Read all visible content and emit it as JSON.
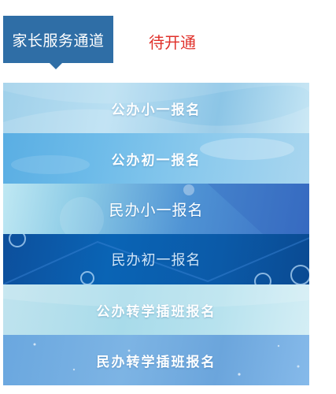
{
  "header": {
    "tab_label": "家长服务通道",
    "status": "待开通"
  },
  "banners": [
    {
      "label": "公办小一报名"
    },
    {
      "label": "公办初一报名"
    },
    {
      "label": "民办小一报名"
    },
    {
      "label": "民办初一报名"
    },
    {
      "label": "公办转学插班报名"
    },
    {
      "label": "民办转学插班报名"
    }
  ],
  "colors": {
    "tab_background": "#2f6ea6",
    "status_text": "#e0312b",
    "banner_text": "#ffffff"
  }
}
